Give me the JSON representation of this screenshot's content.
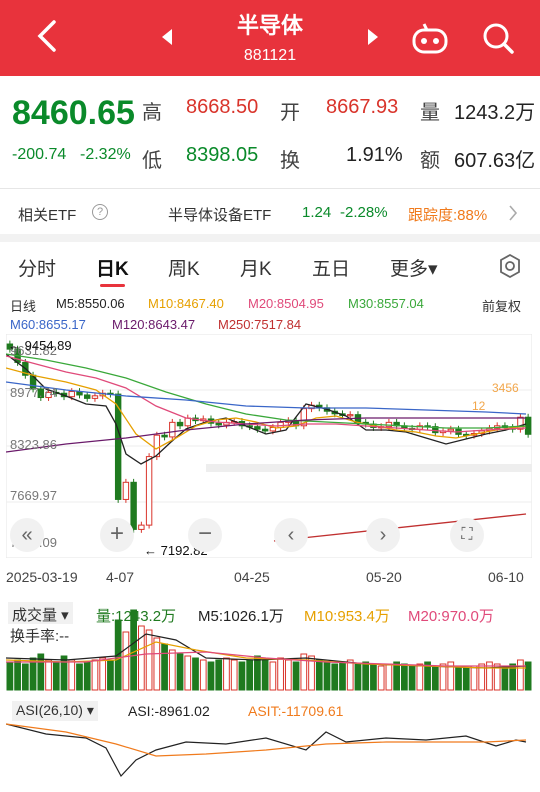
{
  "header": {
    "title": "半导体",
    "code": "881121"
  },
  "quote": {
    "price": "8460.65",
    "change": "-200.74",
    "change_pct": "-2.32%",
    "high_label": "高",
    "high": "8668.50",
    "open_label": "开",
    "open": "8667.93",
    "vol_label": "量",
    "vol": "1243.2万",
    "low_label": "低",
    "low": "8398.05",
    "turn_label": "换",
    "turn": "1.91%",
    "amt_label": "额",
    "amt": "607.63亿"
  },
  "etf": {
    "label": "相关ETF",
    "name": "半导体设备ETF",
    "price": "1.24",
    "pct": "-2.28%",
    "track": "跟踪度:88%"
  },
  "tabs": [
    "分时",
    "日K",
    "周K",
    "月K",
    "五日",
    "更多▾"
  ],
  "ma": {
    "line_label": "日线",
    "ma5": "M5:8550.06",
    "ma10": "M10:8467.40",
    "ma20": "M20:8504.95",
    "ma30": "M30:8557.04",
    "adjust": "前复权",
    "ma60": "M60:8655.17",
    "ma120": "M120:8643.47",
    "ma250": "M250:7517.84"
  },
  "colors": {
    "up": "#d9342b",
    "down": "#1f7a1f",
    "ma5": "#222222",
    "ma10": "#e6a000",
    "ma20": "#e04a7a",
    "ma30": "#3aa83a",
    "ma60": "#3a66c8",
    "ma120": "#6a1a6a",
    "ma250": "#c03030"
  },
  "chart": {
    "yticks": [
      "9631.82",
      "8977.74",
      "8323.86",
      "7669.97",
      "7016.09"
    ],
    "max_note": "9454.89",
    "min_note": "7192.82",
    "xticks": [
      "2025-03-19",
      "4-07",
      "04-25",
      "05-20",
      "06-10"
    ]
  },
  "chart_data": {
    "type": "candlestick",
    "ylim": [
      7016.09,
      9631.82
    ],
    "x": [
      "2025-03-19",
      "04-07",
      "04-25",
      "05-20",
      "06-10"
    ],
    "close": [
      9454.89,
      9300,
      9150,
      8990,
      8890,
      8950,
      8940,
      8900,
      8960,
      8920,
      8880,
      8910,
      8940,
      8930,
      7700,
      7900,
      7350,
      7400,
      8200,
      8450,
      8430,
      8600,
      8560,
      8650,
      8620,
      8640,
      8590,
      8570,
      8600,
      8610,
      8560,
      8550,
      8520,
      8500,
      8540,
      8600,
      8620,
      8560,
      8760,
      8800,
      8770,
      8730,
      8700,
      8680,
      8690,
      8600,
      8580,
      8540,
      8550,
      8600,
      8560,
      8530,
      8520,
      8560,
      8550,
      8480,
      8500,
      8520,
      8460,
      8450,
      8470,
      8500,
      8530,
      8560,
      8540,
      8520,
      8660,
      8460.65
    ]
  },
  "volume": {
    "label": "成交量",
    "vol": "量:1243.2万",
    "m5": "M5:1026.1万",
    "m10": "M10:953.4万",
    "m20": "M20:970.0万",
    "turn": "换手率:--"
  },
  "asi": {
    "label": "ASI(26,10)",
    "asi": "ASI:-8961.02",
    "asit": "ASIT:-11709.61"
  }
}
